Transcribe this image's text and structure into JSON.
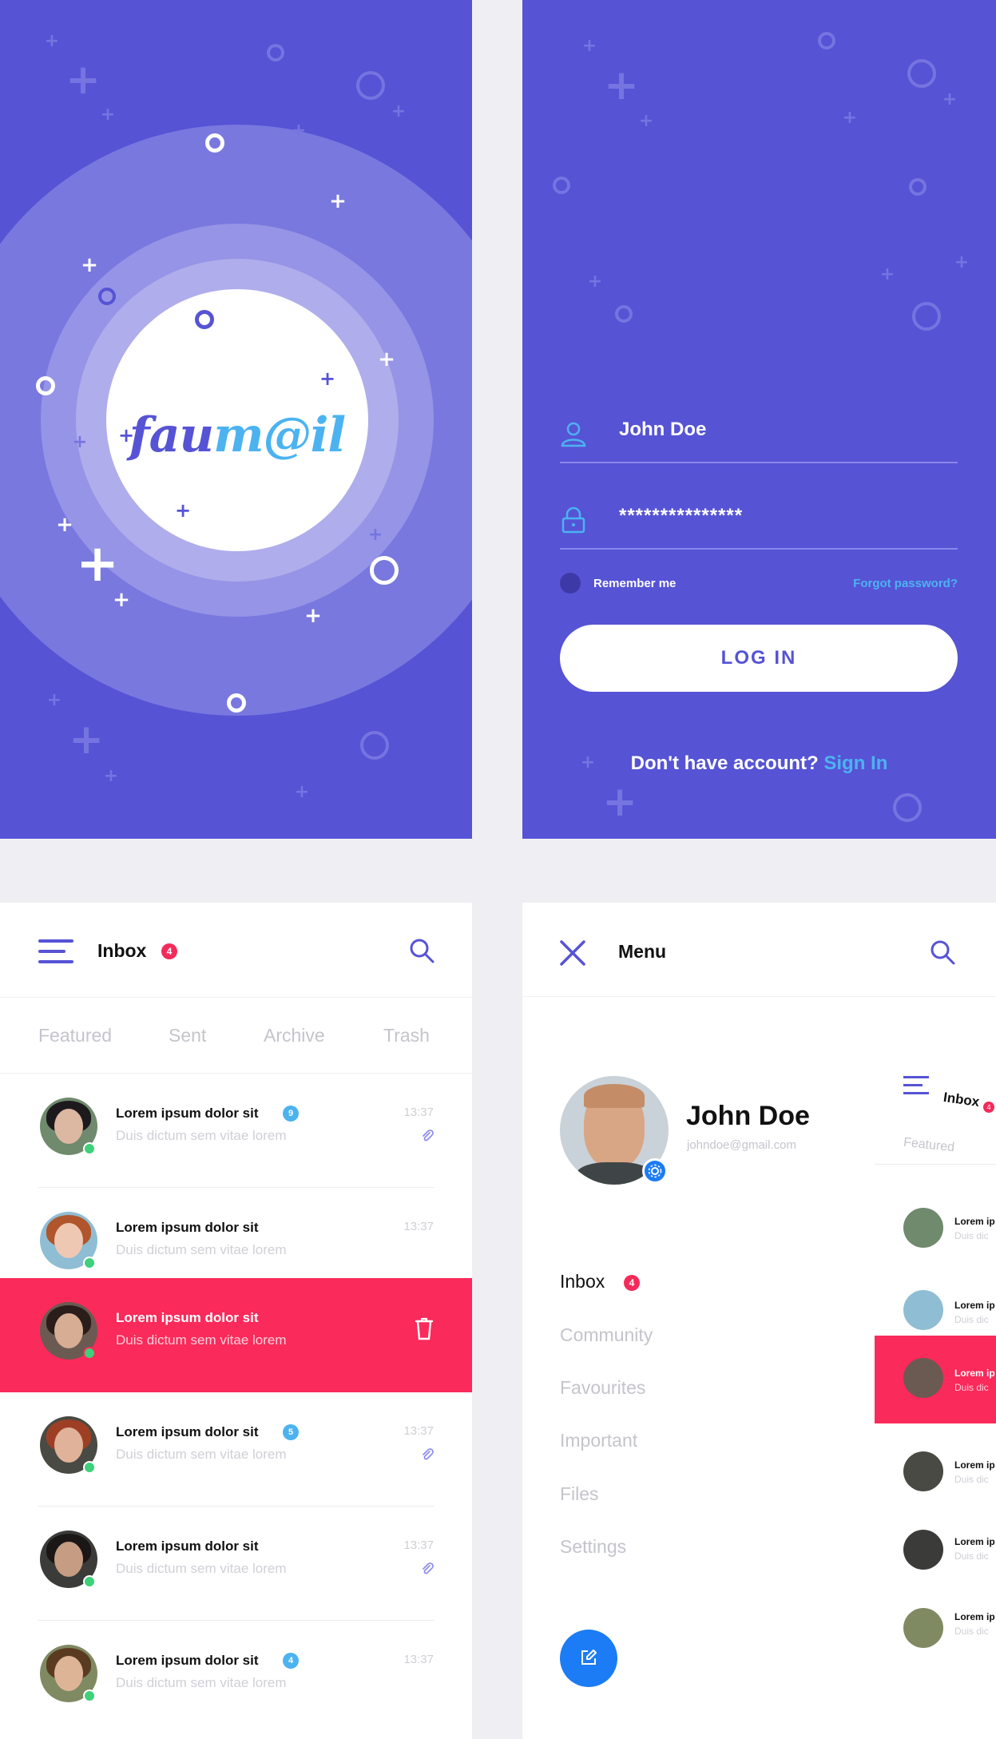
{
  "splash": {
    "logo_part1": "fau",
    "logo_part2": "m@il"
  },
  "login": {
    "username_value": "John Doe",
    "password_value": "***************",
    "remember_label": "Remember me",
    "forgot_label": "Forgot password?",
    "login_button": "LOG IN",
    "signup_prompt": "Don't have account?",
    "signup_link": "Sign In"
  },
  "inbox": {
    "title": "Inbox",
    "badge": "4",
    "tabs": [
      "Featured",
      "Sent",
      "Archive",
      "Trash"
    ],
    "messages": [
      {
        "title": "Lorem ipsum dolor sit",
        "subtitle": "Duis dictum sem vitae lorem",
        "time": "13:37",
        "count": "9",
        "attachment": true
      },
      {
        "title": "Lorem ipsum dolor sit",
        "subtitle": "Duis dictum sem vitae lorem",
        "time": "13:37",
        "count": "",
        "attachment": false
      },
      {
        "title": "Lorem ipsum dolor sit",
        "subtitle": "Duis dictum sem vitae lorem",
        "time": "",
        "count": "",
        "attachment": false,
        "swiped": true
      },
      {
        "title": "Lorem ipsum dolor sit",
        "subtitle": "Duis dictum sem vitae lorem",
        "time": "13:37",
        "count": "5",
        "attachment": true
      },
      {
        "title": "Lorem ipsum dolor sit",
        "subtitle": "Duis dictum sem vitae lorem",
        "time": "13:37",
        "count": "",
        "attachment": true
      },
      {
        "title": "Lorem ipsum dolor sit",
        "subtitle": "Duis dictum sem vitae lorem",
        "time": "13:37",
        "count": "4",
        "attachment": false
      }
    ]
  },
  "menu": {
    "title": "Menu",
    "user_name": "John Doe",
    "user_email": "johndoe@gmail.com",
    "items": [
      {
        "label": "Inbox",
        "badge": "4",
        "active": true
      },
      {
        "label": "Community",
        "active": false
      },
      {
        "label": "Favourites",
        "active": false
      },
      {
        "label": "Important",
        "active": false
      },
      {
        "label": "Files",
        "active": false
      },
      {
        "label": "Settings",
        "active": false
      }
    ]
  },
  "preview": {
    "title": "Inbox",
    "badge": "4",
    "tab": "Featured",
    "row_title": "Lorem ip",
    "row_sub": "Duis dic"
  },
  "colors": {
    "primary": "#5653d5",
    "accent": "#4cb3f0",
    "danger": "#f42a5a",
    "online": "#3fd07a",
    "fab": "#1b7cf5"
  }
}
